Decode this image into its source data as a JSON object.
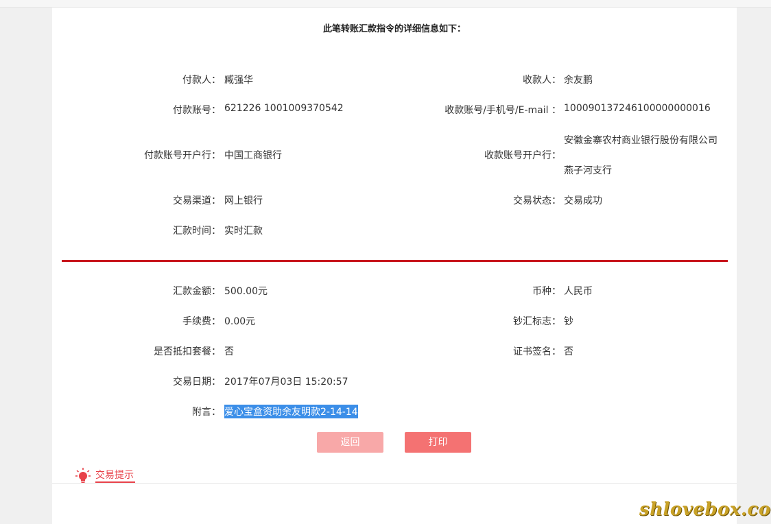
{
  "panel": {
    "title": "此笔转账汇款指令的详细信息如下："
  },
  "left_fields": [
    {
      "label": "付款人：",
      "value": "臧强华"
    },
    {
      "label": "付款账号：",
      "value": "621226 1001009370542"
    },
    {
      "label": "付款账号开户行：",
      "value": "中国工商银行"
    },
    {
      "label": "交易渠道：",
      "value": "网上银行"
    },
    {
      "label": "汇款时间：",
      "value": "实时汇款"
    }
  ],
  "right_fields": [
    {
      "label": "收款人：",
      "value": "余友鹏"
    },
    {
      "label": "收款账号/手机号/E-mail ：",
      "value": "100090137246100000000016"
    },
    {
      "label": "收款账号开户行：",
      "value_line1": "安徽金寨农村商业银行股份有限公司",
      "value_line2": "燕子河支行"
    },
    {
      "label": "交易状态：",
      "value": "交易成功"
    }
  ],
  "amount_left": [
    {
      "label": "汇款金额：",
      "value": "500.00元"
    },
    {
      "label": "手续费：",
      "value": "0.00元"
    },
    {
      "label": "是否抵扣套餐：",
      "value": "否"
    },
    {
      "label": "交易日期：",
      "value": "2017年07月03日 15:20:57"
    },
    {
      "label": "附言：",
      "value": "爱心宝盒资助余友明款2-14-14"
    }
  ],
  "amount_right": [
    {
      "label": "币种：",
      "value": "人民币"
    },
    {
      "label": "钞汇标志：",
      "value": "钞"
    },
    {
      "label": "证书签名：",
      "value": "否"
    }
  ],
  "buttons": {
    "back": "返回",
    "print": "打印"
  },
  "tips": {
    "title": "交易提示",
    "icon": "lightbulb-icon"
  },
  "watermark": "shlovebox.com",
  "colors": {
    "divider": "#c8171e",
    "button_back": "#f8a8a8",
    "button_print": "#f47272",
    "highlight": "#3b8ee8",
    "tips_accent": "#e8424a"
  }
}
